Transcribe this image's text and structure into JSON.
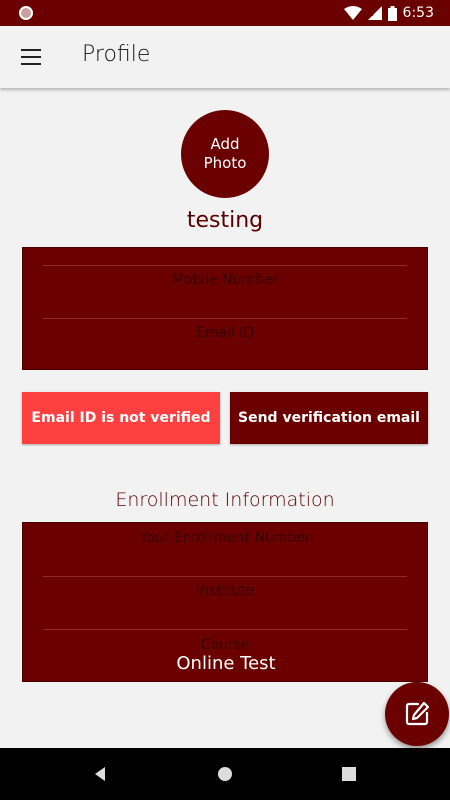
{
  "status_bar": {
    "time": "6:53"
  },
  "app_bar": {
    "title": "Profile"
  },
  "profile": {
    "avatar_line1": "Add",
    "avatar_line2": "Photo",
    "name": "testing"
  },
  "contact": {
    "mobile_placeholder": "Mobile Number",
    "email_placeholder": "Email ID"
  },
  "verification": {
    "status_label": "Email ID is not verified",
    "send_label": "Send verification email"
  },
  "enrollment": {
    "title": "Enrollment Information",
    "enrollment_placeholder": "Your Enrollment Number",
    "institute_placeholder": "Institute",
    "course_placeholder": "Course",
    "course_value": "Online Test"
  },
  "icons": {
    "menu": "menu-icon",
    "edit": "edit-icon",
    "back": "back-icon",
    "home": "home-icon",
    "recents": "recents-icon"
  },
  "colors": {
    "primary": "#6b0000",
    "alert": "#ff4040",
    "background": "#f2f2f2"
  }
}
